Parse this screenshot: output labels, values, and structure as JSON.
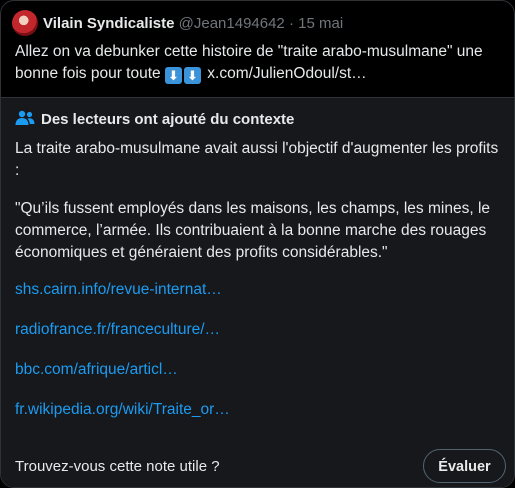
{
  "tweet": {
    "author_name": "Vilain Syndicaliste",
    "handle": "@Jean1494642",
    "separator": "·",
    "date": "15 mai",
    "text_line1": "Allez on va debunker cette histoire de \"traite arabo-musulmane\" une",
    "text_line2_prefix": "bonne fois pour toute",
    "arrow_emoji": "⬇",
    "link_text": "x.com/JulienOdoul/st…"
  },
  "note": {
    "header": "Des lecteurs ont ajouté du contexte",
    "paragraph1": "La traite arabo-musulmane avait aussi  l'objectif d'augmenter les profits :",
    "paragraph2": "\"Qu’ils fussent employés dans les maisons, les champs, les mines, le commerce, l’armée. Ils contribuaient à la bonne marche des rouages économiques et généraient des profits considérables.\"",
    "links": [
      "shs.cairn.info/revue-internat…",
      "radiofrance.fr/franceculture/…",
      "bbc.com/afrique/articl…",
      "fr.wikipedia.org/wiki/Traite_or…"
    ],
    "helpful_question": "Trouvez-vous cette note utile ?",
    "rate_button": "Évaluer"
  },
  "colors": {
    "background": "#000000",
    "note_background": "#16181c",
    "text": "#e7e9ea",
    "muted": "#71767b",
    "link": "#1d9bf0",
    "border": "#2f3336"
  },
  "icons": {
    "avatar": "user-avatar",
    "note_header_icon": "people-icon",
    "arrow": "down-arrow-emoji-icon"
  }
}
